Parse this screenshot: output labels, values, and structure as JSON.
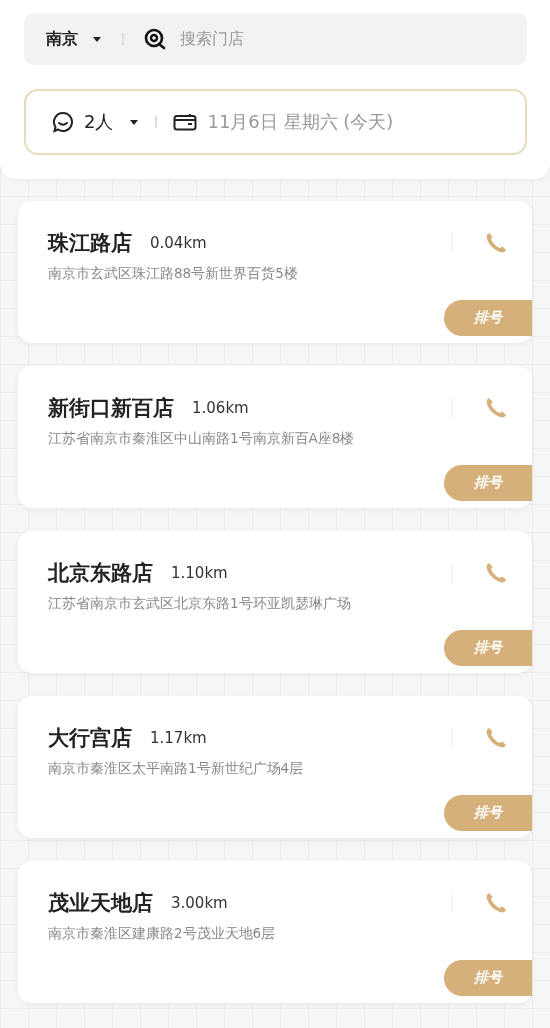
{
  "search_bar": {
    "city": "南京",
    "placeholder": "搜索门店"
  },
  "booking_bar": {
    "party_size": "2人",
    "date": "11月6日 星期六 (今天)"
  },
  "stores": [
    {
      "name": "珠江路店",
      "distance": "0.04km",
      "address": "南京市玄武区珠江路88号新世界百货5楼",
      "button": "排号"
    },
    {
      "name": "新街口新百店",
      "distance": "1.06km",
      "address": "江苏省南京市秦淮区中山南路1号南京新百A座8楼",
      "button": "排号"
    },
    {
      "name": "北京东路店",
      "distance": "1.10km",
      "address": "江苏省南京市玄武区北京东路1号环亚凯瑟琳广场",
      "button": "排号"
    },
    {
      "name": "大行宫店",
      "distance": "1.17km",
      "address": "南京市秦淮区太平南路1号新世纪广场4层",
      "button": "排号"
    },
    {
      "name": "茂业天地店",
      "distance": "3.00km",
      "address": "南京市秦淮区建康路2号茂业天地6层",
      "button": "排号"
    }
  ]
}
